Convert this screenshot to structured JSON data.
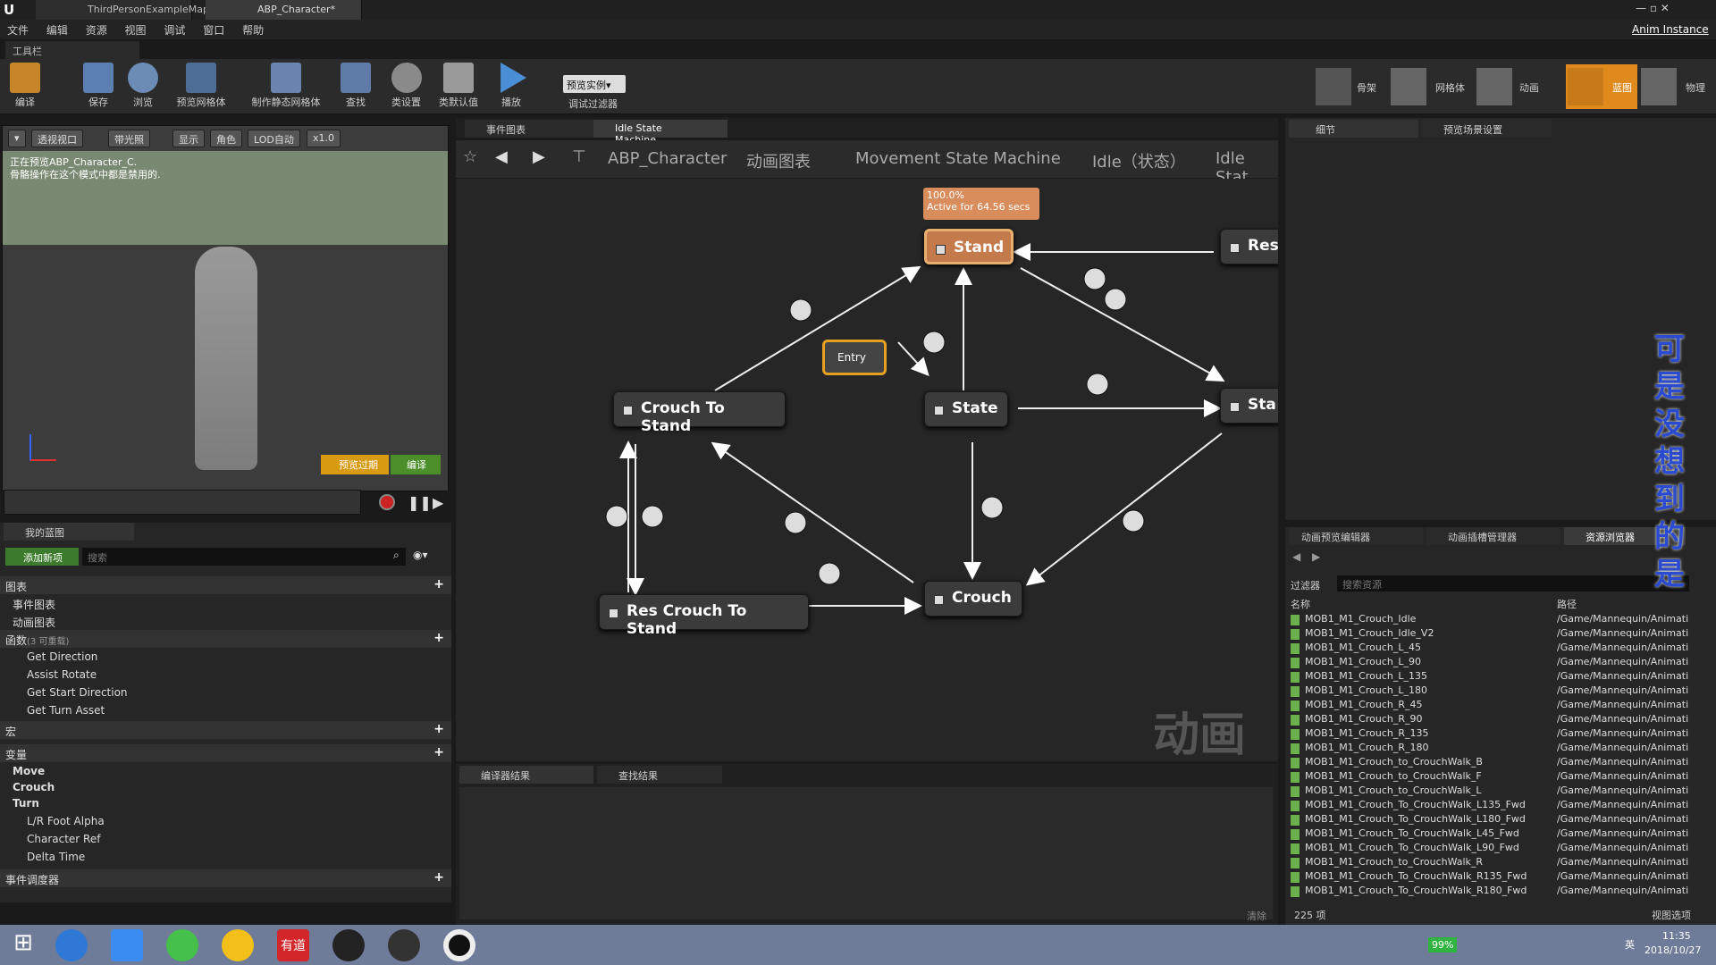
{
  "titlebar": {
    "tab1": "ThirdPersonExampleMap",
    "tab2": "ABP_Character*",
    "right_label": "Anim Instance"
  },
  "menu": [
    "文件",
    "编辑",
    "资源",
    "视图",
    "调试",
    "窗口",
    "帮助"
  ],
  "toolbar": {
    "tab": "工具栏",
    "buttons": [
      "编译",
      "保存",
      "浏览",
      "预览网格体",
      "制作静态网格体",
      "查找",
      "类设置",
      "类默认值",
      "播放"
    ],
    "preview_instance": "预览实例▾",
    "debug_filter": "调试过滤器"
  },
  "modes": [
    "骨架",
    "网格体",
    "动画",
    "蓝图",
    "物理"
  ],
  "viewport": {
    "buttons": [
      "透视视口",
      "带光照",
      "显示",
      "角色",
      "LOD自动",
      "x1.0"
    ],
    "info_line1": "正在预览ABP_Character_C.",
    "info_line2": "骨骼操作在这个模式中都是禁用的.",
    "preview_btn": "预览过期",
    "compile_btn": "编译"
  },
  "my_blueprint": {
    "tab": "我的蓝图",
    "add_new": "添加新项",
    "search_placeholder": "搜索",
    "graphs_hdr": "图表",
    "graphs": [
      "事件图表",
      "动画图表"
    ],
    "functions_hdr": "函数",
    "functions_note": "(3 可重载)",
    "functions": [
      "Get Direction",
      "Assist Rotate",
      "Get Start Direction",
      "Get Turn Asset"
    ],
    "macros_hdr": "宏",
    "variables_hdr": "变量",
    "var_groups": [
      "Move",
      "Crouch",
      "Turn"
    ],
    "variables": [
      "L/R Foot Alpha",
      "Character Ref",
      "Delta Time"
    ],
    "dispatchers_hdr": "事件调度器"
  },
  "graph": {
    "tabs": [
      "事件图表",
      "Idle State Machine"
    ],
    "breadcrumb": [
      "ABP_Character",
      "动画图表",
      "Movement State Machine",
      "Idle（状态）",
      "Idle Stat"
    ],
    "watermark": "动画",
    "active_pct": "100.0%",
    "active_time": "Active for 64.56 secs",
    "nodes": {
      "stand": "Stand",
      "state": "State",
      "crouch": "Crouch",
      "crouch_to_stand": "Crouch To Stand",
      "res_crouch_to_stand": "Res Crouch To Stand",
      "res": "Res",
      "sta": "Sta",
      "entry": "Entry"
    }
  },
  "output": {
    "tabs": [
      "编译器结果",
      "查找结果"
    ],
    "clear": "清除"
  },
  "details": {
    "tabs": [
      "细节",
      "预览场景设置"
    ]
  },
  "assets": {
    "tabs": [
      "动画预览编辑器",
      "动画插槽管理器",
      "资源浏览器"
    ],
    "filter": "过滤器",
    "search_placeholder": "搜索资源",
    "col_name": "名称",
    "col_path": "路径",
    "count": "225 项",
    "view_options": "视图选项",
    "rows": [
      [
        "MOB1_M1_Crouch_Idle",
        "/Game/Mannequin/Animati"
      ],
      [
        "MOB1_M1_Crouch_Idle_V2",
        "/Game/Mannequin/Animati"
      ],
      [
        "MOB1_M1_Crouch_L_45",
        "/Game/Mannequin/Animati"
      ],
      [
        "MOB1_M1_Crouch_L_90",
        "/Game/Mannequin/Animati"
      ],
      [
        "MOB1_M1_Crouch_L_135",
        "/Game/Mannequin/Animati"
      ],
      [
        "MOB1_M1_Crouch_L_180",
        "/Game/Mannequin/Animati"
      ],
      [
        "MOB1_M1_Crouch_R_45",
        "/Game/Mannequin/Animati"
      ],
      [
        "MOB1_M1_Crouch_R_90",
        "/Game/Mannequin/Animati"
      ],
      [
        "MOB1_M1_Crouch_R_135",
        "/Game/Mannequin/Animati"
      ],
      [
        "MOB1_M1_Crouch_R_180",
        "/Game/Mannequin/Animati"
      ],
      [
        "MOB1_M1_Crouch_to_CrouchWalk_B",
        "/Game/Mannequin/Animati"
      ],
      [
        "MOB1_M1_Crouch_to_CrouchWalk_F",
        "/Game/Mannequin/Animati"
      ],
      [
        "MOB1_M1_Crouch_to_CrouchWalk_L",
        "/Game/Mannequin/Animati"
      ],
      [
        "MOB1_M1_Crouch_To_CrouchWalk_L135_Fwd",
        "/Game/Mannequin/Animati"
      ],
      [
        "MOB1_M1_Crouch_To_CrouchWalk_L180_Fwd",
        "/Game/Mannequin/Animati"
      ],
      [
        "MOB1_M1_Crouch_To_CrouchWalk_L45_Fwd",
        "/Game/Mannequin/Animati"
      ],
      [
        "MOB1_M1_Crouch_To_CrouchWalk_L90_Fwd",
        "/Game/Mannequin/Animati"
      ],
      [
        "MOB1_M1_Crouch_to_CrouchWalk_R",
        "/Game/Mannequin/Animati"
      ],
      [
        "MOB1_M1_Crouch_To_CrouchWalk_R135_Fwd",
        "/Game/Mannequin/Animati"
      ],
      [
        "MOB1_M1_Crouch_To_CrouchWalk_R180_Fwd",
        "/Game/Mannequin/Animati"
      ]
    ]
  },
  "subtitle": "可是没想到的是",
  "taskbar": {
    "battery": "99%",
    "time": "11:35",
    "date": "2018/10/27",
    "lang": "英",
    "youdao": "有道"
  }
}
